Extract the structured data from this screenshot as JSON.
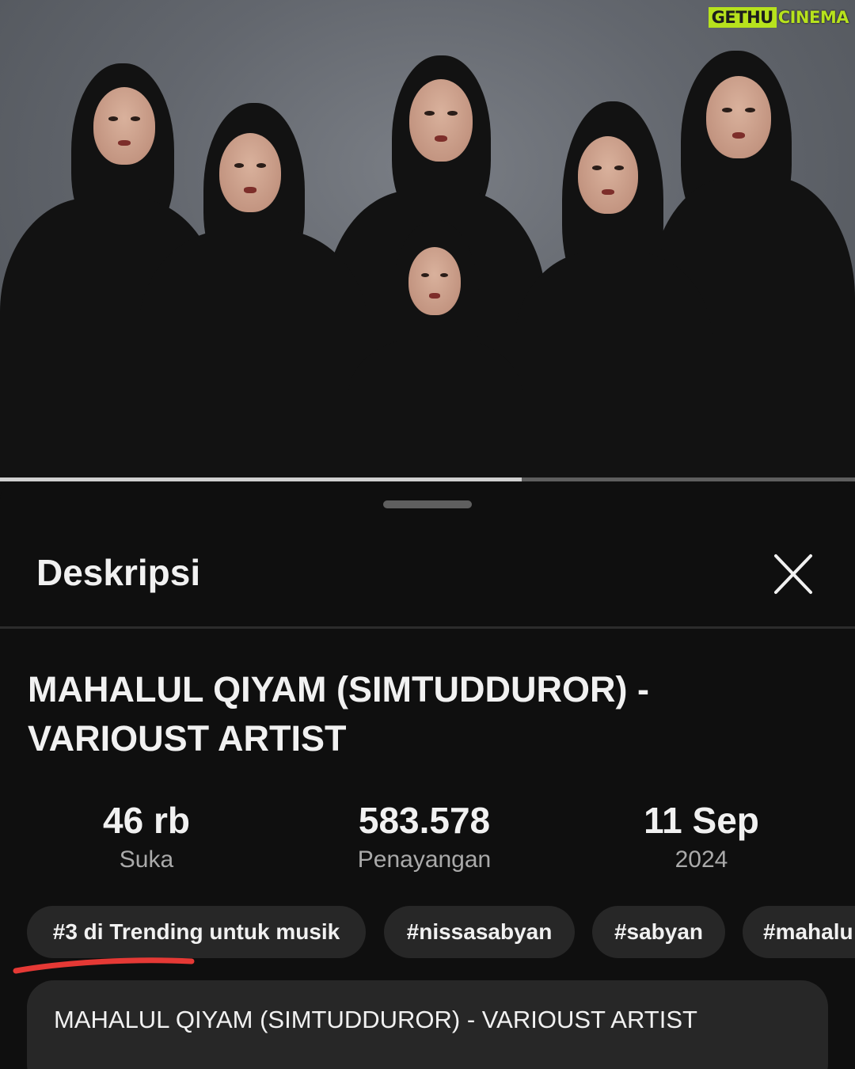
{
  "watermark": {
    "part_a": "GETHU",
    "part_b": "CINEMA"
  },
  "player": {
    "progress": 0.61
  },
  "sheet": {
    "title": "Deskripsi",
    "close_icon": "close-icon"
  },
  "video": {
    "title_line1": "MAHALUL QIYAM (SIMTUDDUROR) -",
    "title_line2": "VARIOUST ARTIST",
    "stats": [
      {
        "value": "46 rb",
        "label": "Suka"
      },
      {
        "value": "583.578",
        "label": "Penayangan"
      },
      {
        "value": "11 Sep",
        "label": "2024"
      }
    ],
    "chips": [
      {
        "label": "#3 di Trending untuk musik"
      },
      {
        "label": "#nissasabyan"
      },
      {
        "label": "#sabyan"
      },
      {
        "label": "#mahalu"
      }
    ],
    "description": "MAHALUL QIYAM (SIMTUDDUROR) - VARIOUST ARTIST"
  },
  "colors": {
    "background": "#0f0f0f",
    "chip": "#272727",
    "annotation_underline": "#e53935",
    "watermark_accent": "#b7e21d"
  }
}
